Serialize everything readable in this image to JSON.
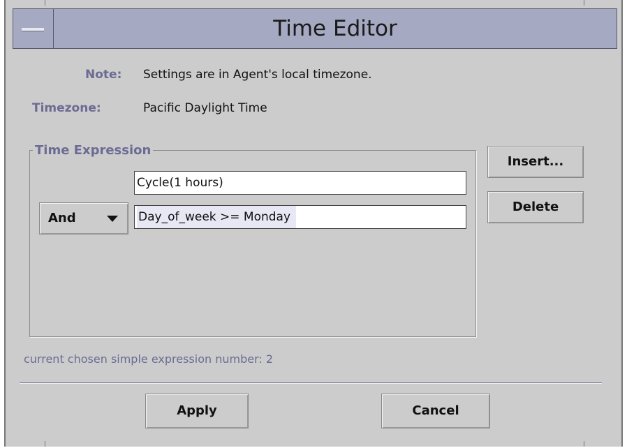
{
  "window": {
    "title": "Time Editor"
  },
  "info": {
    "note_label": "Note:",
    "note_text": "Settings are in Agent's local timezone.",
    "timezone_label": "Timezone:",
    "timezone_value": "Pacific Daylight Time"
  },
  "time_expression": {
    "group_label": "Time Expression",
    "expressions": [
      {
        "value": "Cycle(1 hours)"
      },
      {
        "operator": "And",
        "value": "Day_of_week >= Monday",
        "selected": true
      }
    ]
  },
  "side_buttons": {
    "insert_label": "Insert...",
    "delete_label": "Delete"
  },
  "status": {
    "text": "current chosen simple expression number: 2"
  },
  "footer": {
    "apply_label": "Apply",
    "cancel_label": "Cancel"
  },
  "colors": {
    "window_bg": "#cccccc",
    "titlebar_bg": "#a5a9c2",
    "label_color": "#6b6b94",
    "selection_bg": "#e8e8f5"
  },
  "icons": {
    "window_menu": "window-menu-icon",
    "dropdown": "chevron-down-icon"
  }
}
